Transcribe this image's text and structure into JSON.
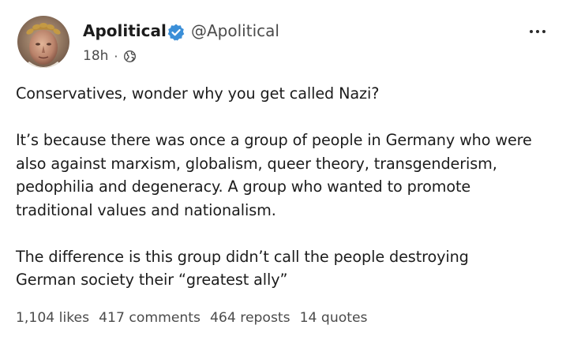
{
  "post": {
    "author": {
      "name": "Apolitical",
      "handle": "@Apolitical",
      "verified": true,
      "avatar_icon": "laurel-crowned-face-avatar"
    },
    "meta": {
      "time": "18h",
      "separator": "·",
      "visibility_icon": "globe-icon"
    },
    "more_icon": "more-horizontal-icon",
    "body": {
      "paragraph_1": "Conservatives, wonder why you get called Nazi?",
      "paragraph_2_line_1": "It’s because there was once a group of people in Germany who were",
      "paragraph_2_line_2": "also against marxism, globalism, queer theory, transgenderism,",
      "paragraph_2_line_3": "pedophilia and degeneracy. A group who wanted to promote",
      "paragraph_2_line_4": "traditional values and nationalism.",
      "paragraph_3_line_1": "The difference is this group didn’t call the people destroying",
      "paragraph_3_line_2": "German society their “greatest ally”"
    },
    "stats": {
      "likes": "1,104 likes",
      "comments": "417 comments",
      "reposts": "464 reposts",
      "quotes": "14 quotes"
    }
  },
  "colors": {
    "text": "#1c1c1c",
    "muted_text": "#4b4b4b",
    "verified_badge": "#3b8fd8",
    "background": "#ffffff"
  }
}
